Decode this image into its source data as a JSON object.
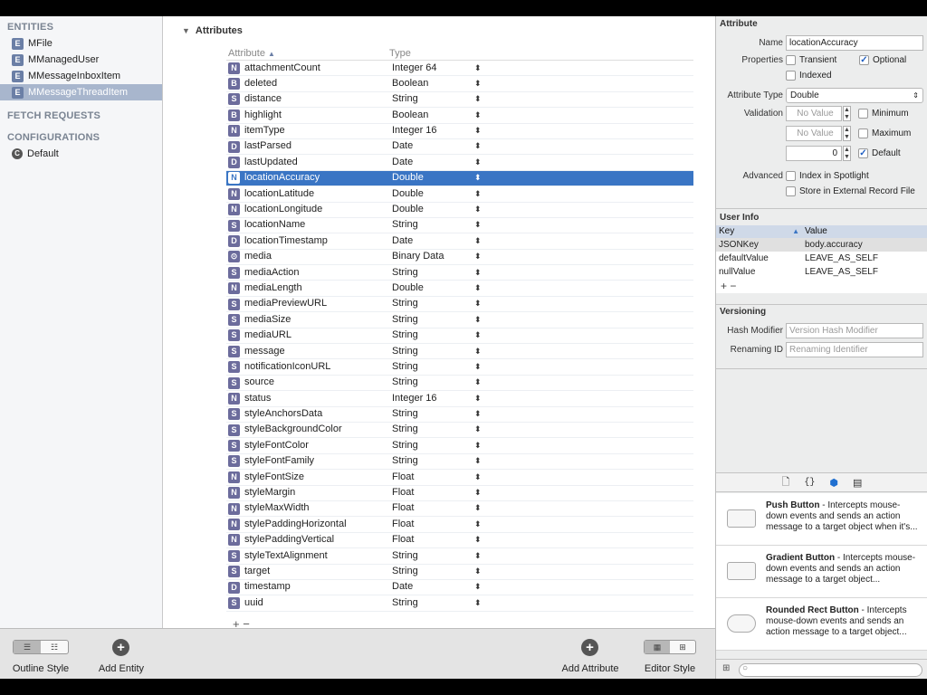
{
  "sidebar": {
    "entities_header": "ENTITIES",
    "entities": [
      {
        "badge": "E",
        "label": "MFile"
      },
      {
        "badge": "E",
        "label": "MManagedUser"
      },
      {
        "badge": "E",
        "label": "MMessageInboxItem"
      },
      {
        "badge": "E",
        "label": "MMessageThreadItem"
      }
    ],
    "fetch_header": "FETCH REQUESTS",
    "config_header": "CONFIGURATIONS",
    "config_item": {
      "badge": "C",
      "label": "Default"
    }
  },
  "attributes": {
    "section_title": "Attributes",
    "col_attribute": "Attribute",
    "col_type": "Type",
    "rows": [
      {
        "badge": "N",
        "name": "attachmentCount",
        "type": "Integer 64"
      },
      {
        "badge": "B",
        "name": "deleted",
        "type": "Boolean"
      },
      {
        "badge": "S",
        "name": "distance",
        "type": "String"
      },
      {
        "badge": "B",
        "name": "highlight",
        "type": "Boolean"
      },
      {
        "badge": "N",
        "name": "itemType",
        "type": "Integer 16"
      },
      {
        "badge": "D",
        "name": "lastParsed",
        "type": "Date"
      },
      {
        "badge": "D",
        "name": "lastUpdated",
        "type": "Date"
      },
      {
        "badge": "N",
        "name": "locationAccuracy",
        "type": "Double"
      },
      {
        "badge": "N",
        "name": "locationLatitude",
        "type": "Double"
      },
      {
        "badge": "N",
        "name": "locationLongitude",
        "type": "Double"
      },
      {
        "badge": "S",
        "name": "locationName",
        "type": "String"
      },
      {
        "badge": "D",
        "name": "locationTimestamp",
        "type": "Date"
      },
      {
        "badge": "⊙",
        "name": "media",
        "type": "Binary Data"
      },
      {
        "badge": "S",
        "name": "mediaAction",
        "type": "String"
      },
      {
        "badge": "N",
        "name": "mediaLength",
        "type": "Double"
      },
      {
        "badge": "S",
        "name": "mediaPreviewURL",
        "type": "String"
      },
      {
        "badge": "S",
        "name": "mediaSize",
        "type": "String"
      },
      {
        "badge": "S",
        "name": "mediaURL",
        "type": "String"
      },
      {
        "badge": "S",
        "name": "message",
        "type": "String"
      },
      {
        "badge": "S",
        "name": "notificationIconURL",
        "type": "String"
      },
      {
        "badge": "S",
        "name": "source",
        "type": "String"
      },
      {
        "badge": "N",
        "name": "status",
        "type": "Integer 16"
      },
      {
        "badge": "S",
        "name": "styleAnchorsData",
        "type": "String"
      },
      {
        "badge": "S",
        "name": "styleBackgroundColor",
        "type": "String"
      },
      {
        "badge": "S",
        "name": "styleFontColor",
        "type": "String"
      },
      {
        "badge": "S",
        "name": "styleFontFamily",
        "type": "String"
      },
      {
        "badge": "N",
        "name": "styleFontSize",
        "type": "Float"
      },
      {
        "badge": "N",
        "name": "styleMargin",
        "type": "Float"
      },
      {
        "badge": "N",
        "name": "styleMaxWidth",
        "type": "Float"
      },
      {
        "badge": "N",
        "name": "stylePaddingHorizontal",
        "type": "Float"
      },
      {
        "badge": "N",
        "name": "stylePaddingVertical",
        "type": "Float"
      },
      {
        "badge": "S",
        "name": "styleTextAlignment",
        "type": "String"
      },
      {
        "badge": "S",
        "name": "target",
        "type": "String"
      },
      {
        "badge": "D",
        "name": "timestamp",
        "type": "Date"
      },
      {
        "badge": "S",
        "name": "uuid",
        "type": "String"
      }
    ],
    "add_remove": "+ −"
  },
  "inspector": {
    "header": "Attribute",
    "name_label": "Name",
    "name_value": "locationAccuracy",
    "properties_label": "Properties",
    "transient": "Transient",
    "optional": "Optional",
    "indexed": "Indexed",
    "attribute_type_label": "Attribute Type",
    "attribute_type_value": "Double",
    "validation_label": "Validation",
    "min_placeholder": "No Value",
    "max_placeholder": "No Value",
    "minimum": "Minimum",
    "maximum": "Maximum",
    "default_value": "0",
    "default_label": "Default",
    "advanced_label": "Advanced",
    "index_spotlight": "Index in Spotlight",
    "store_external": "Store in External Record File",
    "user_info_header": "User Info",
    "ui_col_key": "Key",
    "ui_col_value": "Value",
    "user_info": [
      {
        "key": "JSONKey",
        "value": "body.accuracy"
      },
      {
        "key": "defaultValue",
        "value": "LEAVE_AS_SELF"
      },
      {
        "key": "nullValue",
        "value": "LEAVE_AS_SELF"
      }
    ],
    "ui_add_remove": "+ −",
    "versioning_header": "Versioning",
    "hash_label": "Hash Modifier",
    "hash_placeholder": "Version Hash Modifier",
    "renaming_label": "Renaming ID",
    "renaming_placeholder": "Renaming Identifier"
  },
  "library": [
    {
      "title": "Push Button",
      "desc": " - Intercepts mouse-down events and sends an action message to a target object when it's..."
    },
    {
      "title": "Gradient Button",
      "desc": " - Intercepts mouse-down events and sends an action message to a target object..."
    },
    {
      "title": "Rounded Rect Button",
      "desc": " - Intercepts mouse-down events and sends an action message to a target object..."
    }
  ],
  "bottom": {
    "outline_style": "Outline Style",
    "add_entity": "Add Entity",
    "add_attribute": "Add Attribute",
    "editor_style": "Editor Style"
  }
}
